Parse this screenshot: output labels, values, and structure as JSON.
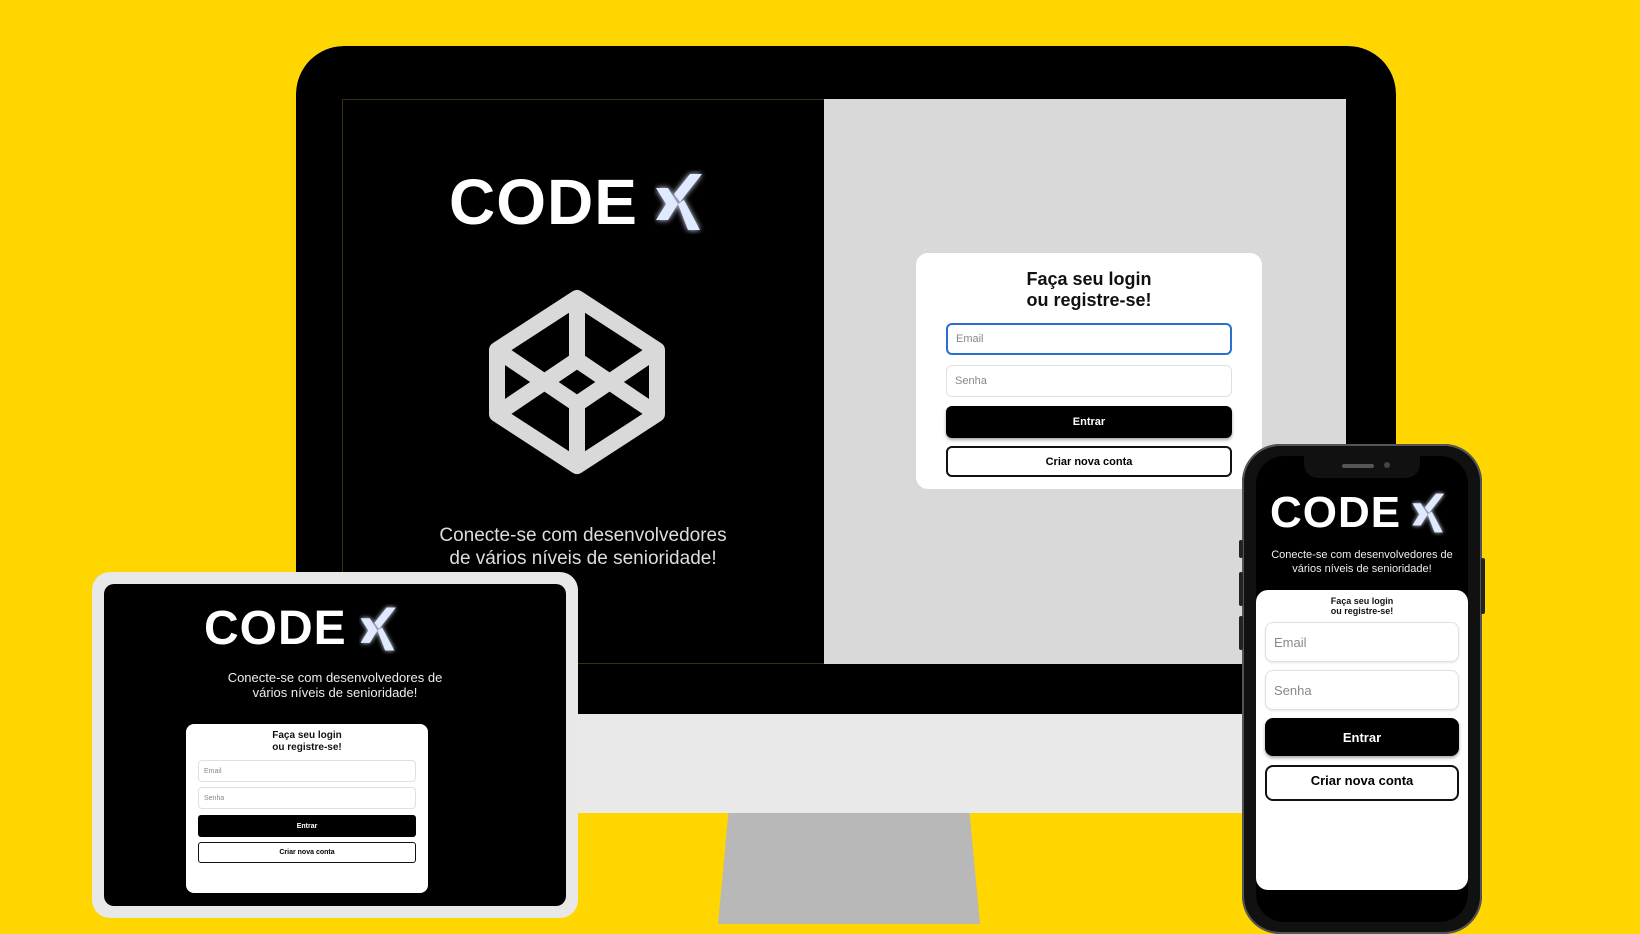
{
  "brand": {
    "logo_text": "CODE",
    "logo_icon": "glowing-x-mark-icon",
    "cube_icon": "codepen-cube-icon",
    "colors": {
      "background": "#FFD600",
      "panel_dark": "#000000",
      "panel_light": "#D9D9D9",
      "focus": "#2A6FD0"
    }
  },
  "desktop": {
    "tagline_line1": "Conecte-se com desenvolvedores",
    "tagline_line2": "de vários níveis de senioridade!",
    "login": {
      "title_line1": "Faça seu login",
      "title_line2": "ou registre-se!",
      "email_placeholder": "Email",
      "password_placeholder": "Senha",
      "submit_label": "Entrar",
      "register_label": "Criar nova conta"
    }
  },
  "tablet": {
    "tagline_line1": "Conecte-se com desenvolvedores de",
    "tagline_line2": "vários níveis de senioridade!",
    "login": {
      "title_line1": "Faça seu login",
      "title_line2": "ou registre-se!",
      "email_placeholder": "Email",
      "password_placeholder": "Senha",
      "submit_label": "Entrar",
      "register_label": "Criar nova conta"
    }
  },
  "mobile": {
    "tagline_line1": "Conecte-se com desenvolvedores de",
    "tagline_line2": "vários níveis de senioridade!",
    "login": {
      "title_line1": "Faça seu login",
      "title_line2": "ou registre-se!",
      "email_placeholder": "Email",
      "password_placeholder": "Senha",
      "submit_label": "Entrar",
      "register_label": "Criar nova conta"
    }
  }
}
